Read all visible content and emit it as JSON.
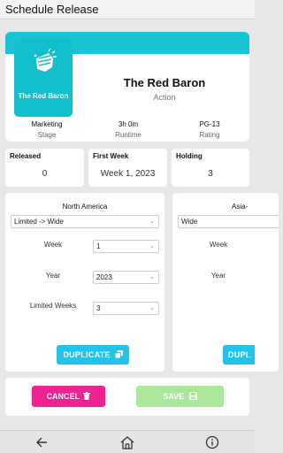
{
  "window": {
    "title": "Schedule Release"
  },
  "movie": {
    "poster_label": "The Red Baron",
    "title": "The Red Baron",
    "genre": "Action",
    "stage": {
      "value": "Marketing",
      "label": "Stage"
    },
    "runtime": {
      "value": "3h 0m",
      "label": "Runtime"
    },
    "rating": {
      "value": "PG-13",
      "label": "Rating"
    }
  },
  "stats": {
    "released": {
      "label": "Released",
      "value": "0"
    },
    "first_week": {
      "label": "First Week",
      "value": "Week 1, 2023"
    },
    "holding": {
      "label": "Holding",
      "value": "3"
    }
  },
  "regions": [
    {
      "name": "North America",
      "release_type": "Limited -> Wide",
      "week_label": "Week",
      "week_value": "1",
      "year_label": "Year",
      "year_value": "2023",
      "limited_weeks_label": "Limited Weeks",
      "limited_weeks_value": "3",
      "duplicate_label": "DUPLICATE"
    },
    {
      "name": "Asia-",
      "release_type": "Wide",
      "week_label": "Week",
      "year_label": "Year",
      "duplicate_label": "DUPL"
    }
  ],
  "actions": {
    "cancel_label": "CANCEL",
    "save_label": "SAVE"
  },
  "colors": {
    "accent": "#19c4d2",
    "cancel": "#ee2290",
    "save": "#a9e89a",
    "duplicate": "#22c3eb"
  },
  "nav": {
    "icons": [
      "back-arrow-icon",
      "home-icon",
      "info-icon"
    ]
  }
}
